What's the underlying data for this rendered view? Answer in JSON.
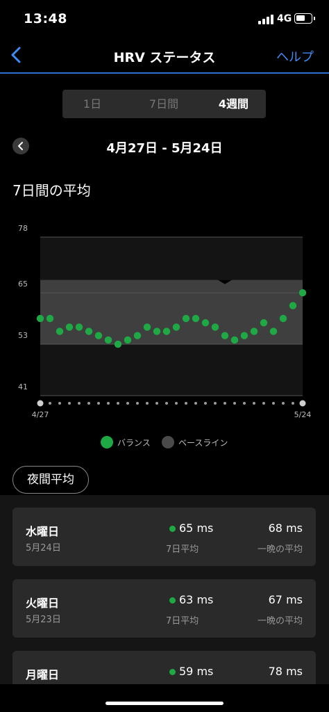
{
  "status": {
    "time": "13:48",
    "network": "4G"
  },
  "nav": {
    "title": "HRV ステータス",
    "help": "ヘルプ"
  },
  "tabs": [
    {
      "label": "1日",
      "active": false
    },
    {
      "label": "7日間",
      "active": false
    },
    {
      "label": "4週間",
      "active": true
    }
  ],
  "date_range": "4月27日 - 5月24日",
  "section_title": "7日間の平均",
  "colors": {
    "balance": "#1fa945",
    "baseline": "#4a4a4a",
    "accent": "#3f8cf5"
  },
  "chart_data": {
    "type": "scatter",
    "y_ticks": [
      78,
      65,
      53,
      41
    ],
    "ylim": [
      41,
      78
    ],
    "x_tick_labels": [
      "4/27",
      "5/24"
    ],
    "baseline_band": [
      53,
      68
    ],
    "series": [
      {
        "name": "バランス",
        "values": [
          59,
          59,
          56,
          57,
          57,
          56,
          55,
          54,
          53,
          54,
          55,
          57,
          56,
          56,
          57,
          59,
          59,
          58,
          57,
          55,
          54,
          55,
          56,
          58,
          56,
          59,
          62,
          65
        ]
      }
    ],
    "legend": [
      {
        "label": "バランス",
        "color": "#1fa945"
      },
      {
        "label": "ベースライン",
        "color": "#4a4a4a"
      }
    ]
  },
  "night_button": "夜間平均",
  "days": [
    {
      "day": "水曜日",
      "date": "5月24日",
      "avg": "65 ms",
      "avg_label": "7日平均",
      "night": "68 ms",
      "night_label": "一晩の平均"
    },
    {
      "day": "火曜日",
      "date": "5月23日",
      "avg": "63 ms",
      "avg_label": "7日平均",
      "night": "67 ms",
      "night_label": "一晩の平均"
    },
    {
      "day": "月曜日",
      "date": "",
      "avg": "59 ms",
      "avg_label": "",
      "night": "78 ms",
      "night_label": ""
    }
  ]
}
